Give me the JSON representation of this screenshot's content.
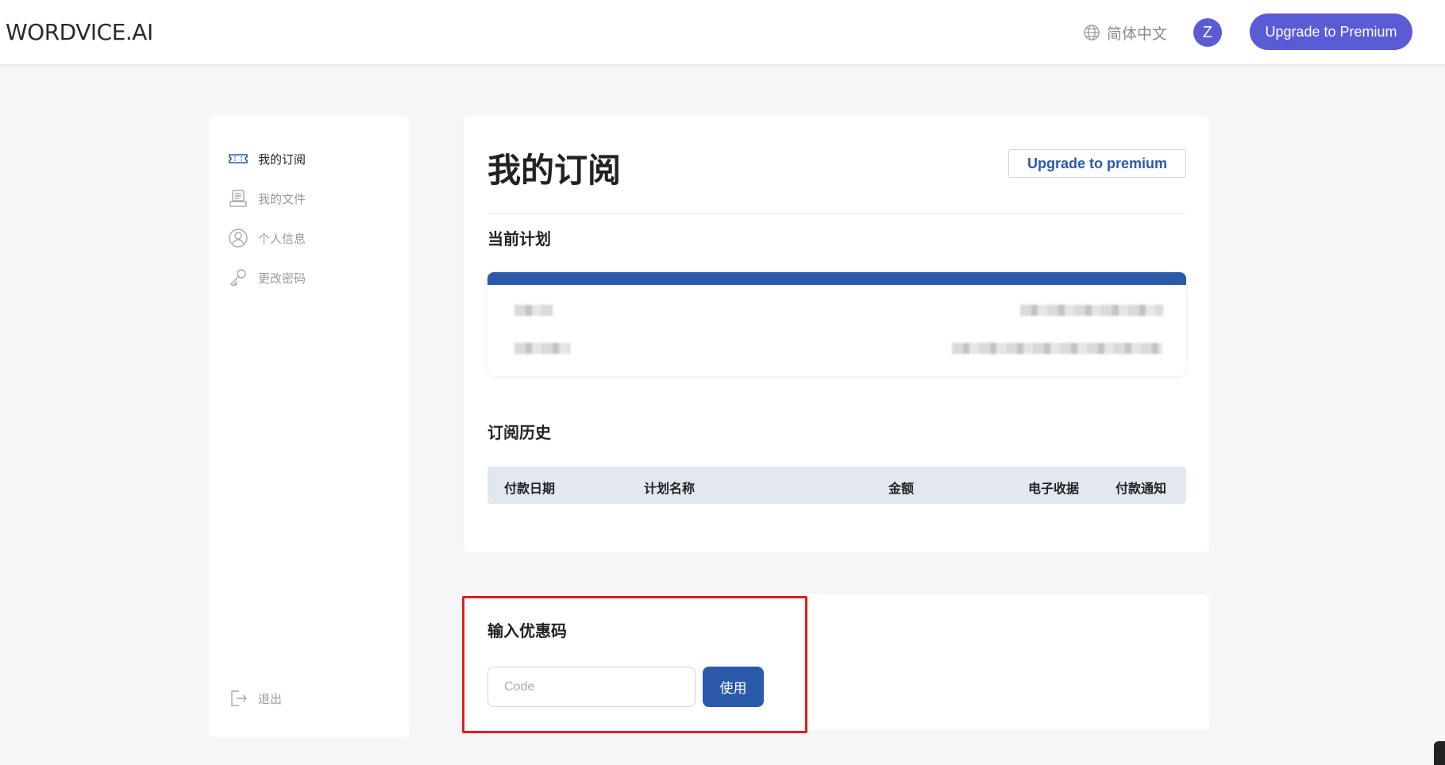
{
  "header": {
    "logo": "WORDVICE.AI",
    "language": "简体中文",
    "avatar_initial": "Z",
    "upgrade_button": "Upgrade to Premium"
  },
  "sidebar": {
    "items": [
      {
        "label": "我的订阅",
        "icon": "ticket-icon",
        "active": true
      },
      {
        "label": "我的文件",
        "icon": "document-icon",
        "active": false
      },
      {
        "label": "个人信息",
        "icon": "user-circle-icon",
        "active": false
      },
      {
        "label": "更改密码",
        "icon": "key-icon",
        "active": false
      }
    ],
    "logout": {
      "label": "退出",
      "icon": "logout-icon"
    }
  },
  "main": {
    "title": "我的订阅",
    "upgrade_button": "Upgrade to premium",
    "current_plan_title": "当前计划",
    "history_title": "订阅历史",
    "history_columns": [
      "付款日期",
      "计划名称",
      "金额",
      "电子收据",
      "付款通知"
    ]
  },
  "coupon": {
    "title": "输入优惠码",
    "input_placeholder": "Code",
    "input_value": "",
    "apply_button": "使用"
  },
  "colors": {
    "brand_purple": "#5b5bd6",
    "brand_blue": "#2a5aa9",
    "highlight_red": "#e0201e"
  }
}
